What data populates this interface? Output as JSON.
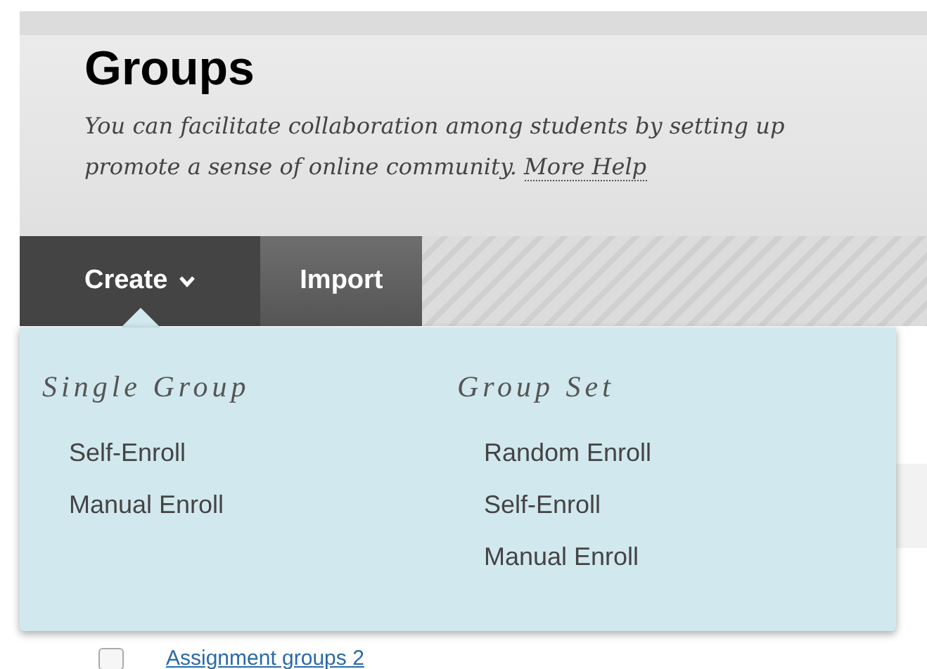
{
  "header": {
    "title": "Groups",
    "description": "You can facilitate collaboration among students by setting up\npromote a sense of online community.",
    "help_link": "More Help"
  },
  "toolbar": [
    {
      "label": "Create",
      "kind": "menu",
      "expanded": true
    },
    {
      "label": "Import",
      "kind": "plain"
    }
  ],
  "menu": [
    {
      "heading": "Single Group",
      "items": [
        "Self-Enroll",
        "Manual Enroll"
      ]
    },
    {
      "heading": "Group Set",
      "items": [
        "Random Enroll",
        "Self-Enroll",
        "Manual Enroll"
      ]
    }
  ],
  "rows": [
    {
      "label": "Assignment groups 2",
      "checked": false
    }
  ]
}
